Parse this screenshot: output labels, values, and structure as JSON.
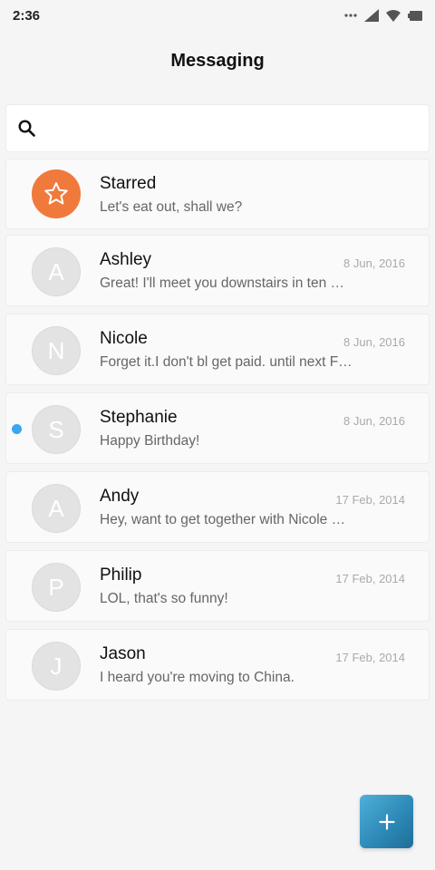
{
  "status_bar": {
    "time": "2:36",
    "icons": [
      "dots-icon",
      "signal-icon",
      "wifi-icon",
      "battery-icon"
    ]
  },
  "header": {
    "title": "Messaging"
  },
  "search": {
    "icon": "search-icon",
    "placeholder": "",
    "value": ""
  },
  "conversations": [
    {
      "name": "Starred",
      "preview": "Let's eat out, shall we?",
      "date": "",
      "avatar_letter": "",
      "avatar_icon": "star-icon",
      "avatar_color": "#f07a3c",
      "unread": false
    },
    {
      "name": "Ashley",
      "preview": "Great! I'll meet you downstairs in ten …",
      "date": "8 Jun, 2016",
      "avatar_letter": "A",
      "unread": false
    },
    {
      "name": "Nicole",
      "preview": "Forget it.I don't bl get paid. until next F…",
      "date": "8 Jun, 2016",
      "avatar_letter": "N",
      "unread": false
    },
    {
      "name": "Stephanie",
      "preview": "Happy Birthday!",
      "date": "8 Jun, 2016",
      "avatar_letter": "S",
      "unread": true,
      "unread_color": "#3aa7f0"
    },
    {
      "name": "Andy",
      "preview": "Hey, want to get together with Nicole …",
      "date": "17 Feb, 2014",
      "avatar_letter": "A",
      "unread": false
    },
    {
      "name": "Philip",
      "preview": "LOL, that's so funny!",
      "date": "17 Feb, 2014",
      "avatar_letter": "P",
      "unread": false
    },
    {
      "name": "Jason",
      "preview": "I heard you're moving to China.",
      "date": "17 Feb, 2014",
      "avatar_letter": "J",
      "unread": false
    }
  ],
  "fab": {
    "icon": "plus-icon",
    "color": "#2e8ab8"
  }
}
